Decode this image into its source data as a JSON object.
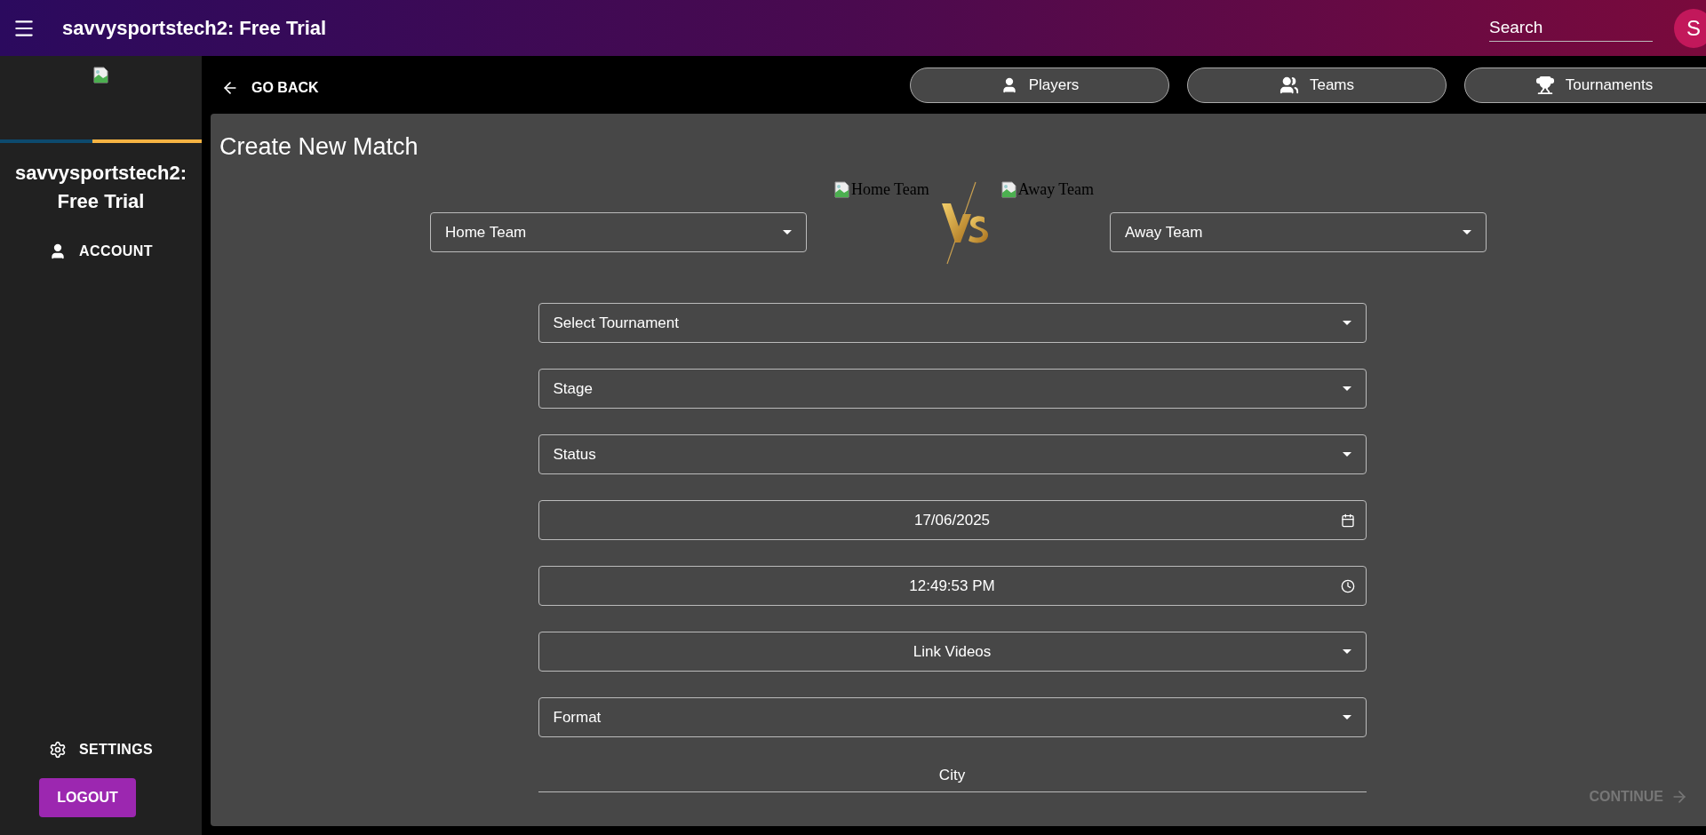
{
  "app_bar": {
    "title": "savvysportstech2: Free Trial",
    "search": {
      "placeholder": "Search"
    },
    "avatar": "S"
  },
  "sidebar": {
    "title": "savvysportstech2: Free Trial",
    "progress": {
      "level": 0.46
    },
    "items": [
      {
        "label": "ACCOUNT",
        "kind": "account"
      }
    ],
    "bottom_items": [
      {
        "label": "SETTINGS",
        "kind": "settings"
      }
    ],
    "logout": "LOGOUT"
  },
  "toolbar": {
    "back": "GO BACK",
    "nav": [
      {
        "label": "Players",
        "kind": "player"
      },
      {
        "label": "Teams",
        "kind": "teams"
      },
      {
        "label": "Tournaments",
        "kind": "trophy"
      }
    ]
  },
  "form": {
    "title": "Create New Match",
    "home": {
      "select": "Home Team",
      "image_alt": "Home Team"
    },
    "away": {
      "select": "Away Team",
      "image_alt": "Away Team"
    },
    "fields": [
      {
        "kind": "select",
        "label": "Select Tournament",
        "centered": false
      },
      {
        "kind": "select",
        "label": "Stage",
        "centered": false
      },
      {
        "kind": "select",
        "label": "Status",
        "centered": false
      },
      {
        "kind": "date",
        "value": "17/06/2025",
        "centered": true
      },
      {
        "kind": "time",
        "value": "12:49:53 PM",
        "centered": true
      },
      {
        "kind": "select",
        "label": "Link Videos",
        "centered": true
      },
      {
        "kind": "select",
        "label": "Format",
        "centered": false
      },
      {
        "kind": "line",
        "placeholder": "City",
        "centered": true
      }
    ],
    "continue": {
      "label": "CONTINUE",
      "disabled": true
    }
  }
}
